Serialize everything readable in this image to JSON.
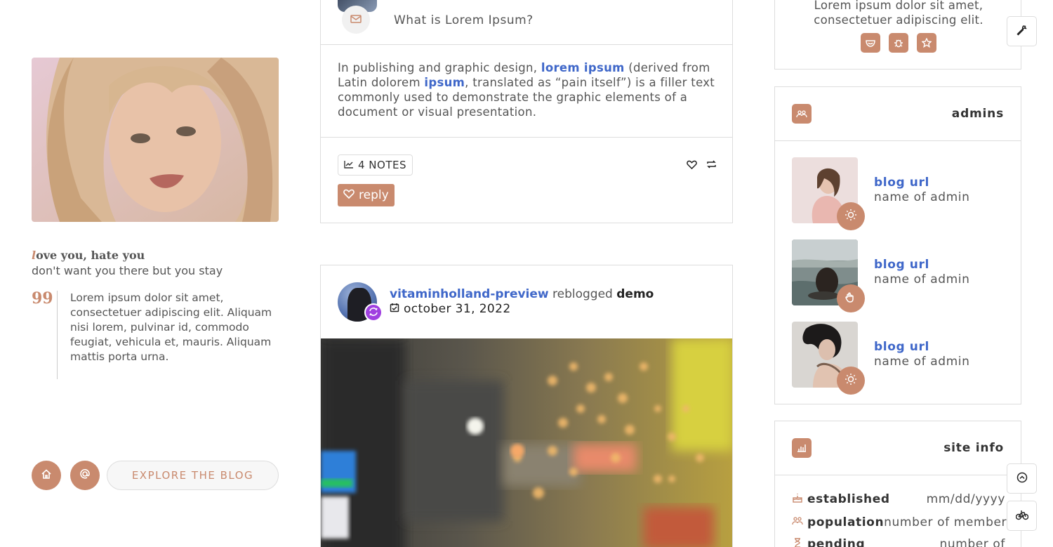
{
  "sidebar": {
    "quote_title_initial": "l",
    "quote_title_rest": "ove you, hate you",
    "quote_subtitle": "don't want you there but you stay",
    "quote_mark": "99",
    "quote_body": "Lorem ipsum dolor sit amet, consectetuer adipiscing elit. Aliquam nisi lorem, pulvinar id, commodo feugiat, vehicula et, mauris. Aliquam mattis porta urna.",
    "home_icon": "home-icon",
    "ask_icon": "at-icon",
    "explore_label": "EXPLORE THE BLOG"
  },
  "post1": {
    "question": "What is Lorem Ipsum?",
    "body_part1": "In publishing and graphic design, ",
    "body_link1": "lorem ipsum",
    "body_part2": " (derived from Latin dolorem ",
    "body_link2": "ipsum",
    "body_part3": ", translated as “pain itself”) is a filler text commonly used to demonstrate the graphic elements of a document or visual presentation.",
    "notes_label": "4 NOTES",
    "reply_label": "reply"
  },
  "post2": {
    "username": "vitaminholland-preview",
    "action": " reblogged ",
    "source": "demo",
    "date": "october 31, 2022"
  },
  "right": {
    "top_text": "Lorem ipsum dolor sit amet, consectetuer adipiscing elit.",
    "admins_title": "admins",
    "admins": [
      {
        "url": "blog url",
        "name": "name of admin",
        "badge_icon": "sun-icon"
      },
      {
        "url": "blog url",
        "name": "name of admin",
        "badge_icon": "hand-icon"
      },
      {
        "url": "blog url",
        "name": "name of admin",
        "badge_icon": "sun-icon"
      }
    ],
    "site_info_title": "site info",
    "site_info": [
      {
        "label": "established",
        "value": "mm/dd/yyyy"
      },
      {
        "label": "population",
        "value": "number of member"
      },
      {
        "label": "pending",
        "value": "number of"
      }
    ]
  },
  "colors": {
    "accent": "#c98a6e",
    "link": "#3f67c9",
    "reblog_badge": "#a040e0"
  }
}
